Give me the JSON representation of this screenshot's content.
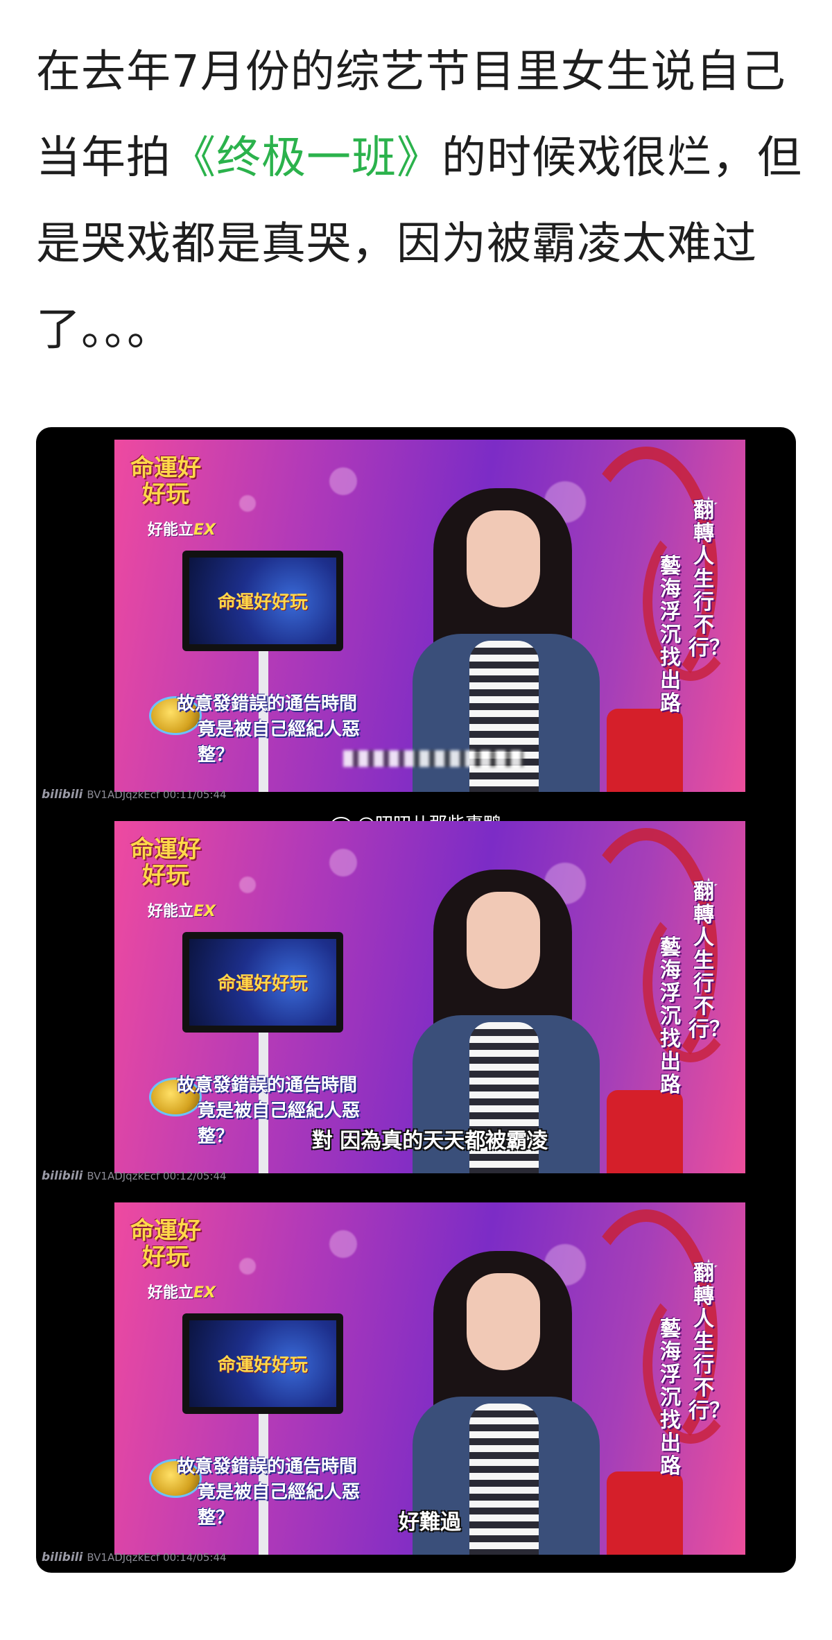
{
  "post": {
    "text_before": "在去年7月份的综艺节目里女生说自己当年拍",
    "highlight": "《终极一班》",
    "text_after": "的时候戏很烂，但是哭戏都是真哭，因为被霸凌太难过了。。。"
  },
  "watermark": {
    "weibo": "@叨叨儿那些事鸭"
  },
  "show": {
    "logo": "命運好好玩",
    "sponsor": "好能立",
    "sponsor_brand": "EX",
    "tv_logo": "命運好好玩",
    "title_a": "翻轉人生行不行？",
    "title_b": "藝海浮沉找出路",
    "topic_1": "故意發錯誤的通告時間",
    "topic_2": "竟是被自己經紀人惡整？"
  },
  "frames": [
    {
      "subtitle": "",
      "timestamp": "BV1ADJqzkEcf 00:11/05:44",
      "platform": "bilibili"
    },
    {
      "subtitle": "對 因為真的天天都被霸凌",
      "timestamp": "BV1ADJqzkEcf 00:12/05:44",
      "platform": "bilibili"
    },
    {
      "subtitle": "好難過",
      "timestamp": "BV1ADJqzkEcf 00:14/05:44",
      "platform": "bilibili"
    }
  ]
}
